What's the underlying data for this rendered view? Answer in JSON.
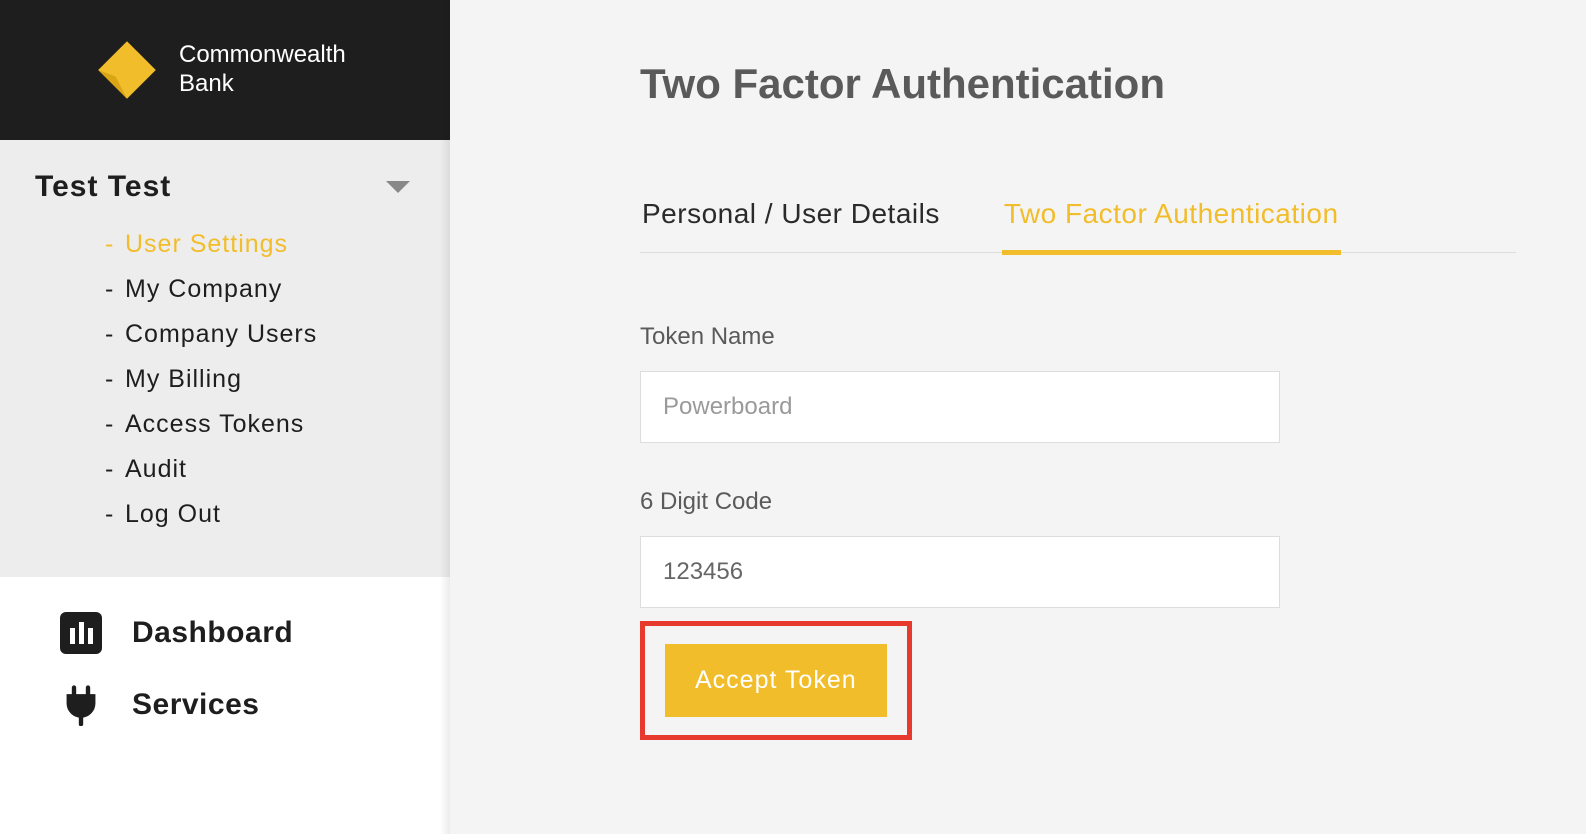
{
  "brand": {
    "name_line1": "Commonwealth",
    "name_line2": "Bank"
  },
  "user": {
    "display_name": "Test  Test",
    "menu": [
      {
        "label": "User  Settings",
        "active": true
      },
      {
        "label": "My  Company",
        "active": false
      },
      {
        "label": "Company  Users",
        "active": false
      },
      {
        "label": "My  Billing",
        "active": false
      },
      {
        "label": "Access  Tokens",
        "active": false
      },
      {
        "label": "Audit",
        "active": false
      },
      {
        "label": "Log  Out",
        "active": false
      }
    ]
  },
  "main_nav": {
    "dashboard_label": "Dashboard",
    "services_label": "Services"
  },
  "page": {
    "title": "Two Factor Authentication",
    "tabs": [
      {
        "label": "Personal / User Details",
        "active": false
      },
      {
        "label": "Two  Factor  Authentication",
        "active": true
      }
    ],
    "form": {
      "token_name_label": "Token Name",
      "token_name_placeholder": "Powerboard",
      "token_name_value": "",
      "code_label": "6 Digit Code",
      "code_value": "123456",
      "accept_label": "Accept Token"
    }
  },
  "colors": {
    "accent": "#f2bd2b",
    "highlight_border": "#e63a2e"
  }
}
